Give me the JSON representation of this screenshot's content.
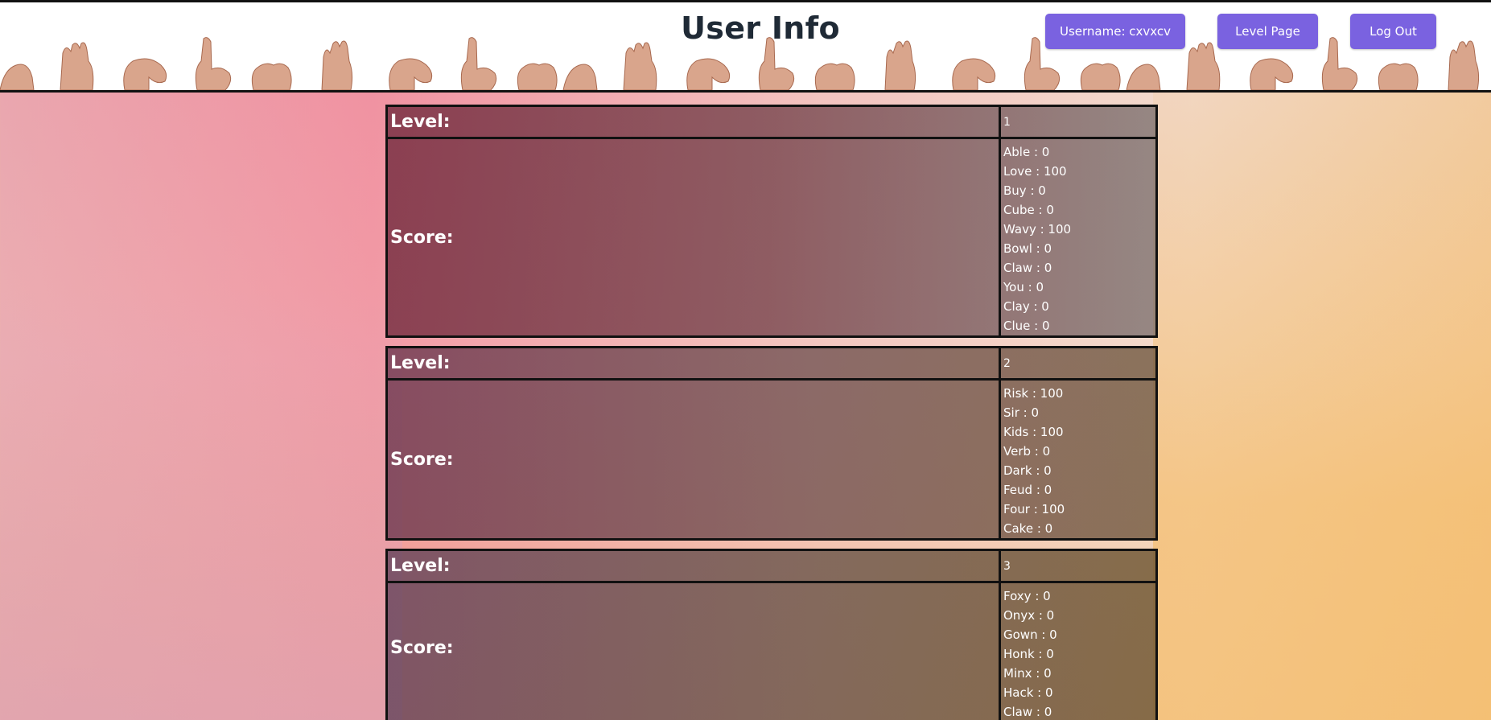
{
  "header": {
    "title": "User Info",
    "username_label": "Username: cxvxcv",
    "level_page_label": "Level Page",
    "logout_label": "Log Out"
  },
  "labels": {
    "level": "Level:",
    "score": "Score:"
  },
  "levels": [
    {
      "level": "1",
      "scores": [
        "Able : 0",
        "Love : 100",
        "Buy : 0",
        "Cube : 0",
        "Wavy : 100",
        "Bowl : 0",
        "Claw : 0",
        "You : 0",
        "Clay : 0",
        "Clue : 0"
      ]
    },
    {
      "level": "2",
      "scores": [
        "Risk : 100",
        "Sir : 0",
        "Kids : 100",
        "Verb : 0",
        "Dark : 0",
        "Feud : 0",
        "Four : 100",
        "Cake : 0"
      ]
    },
    {
      "level": "3",
      "scores": [
        "Foxy : 0",
        "Onyx : 0",
        "Gown : 0",
        "Honk : 0",
        "Minx : 0",
        "Hack : 0",
        "Claw : 0"
      ]
    }
  ],
  "colors": {
    "button": "#7a62e0",
    "title": "#1f2a36"
  }
}
